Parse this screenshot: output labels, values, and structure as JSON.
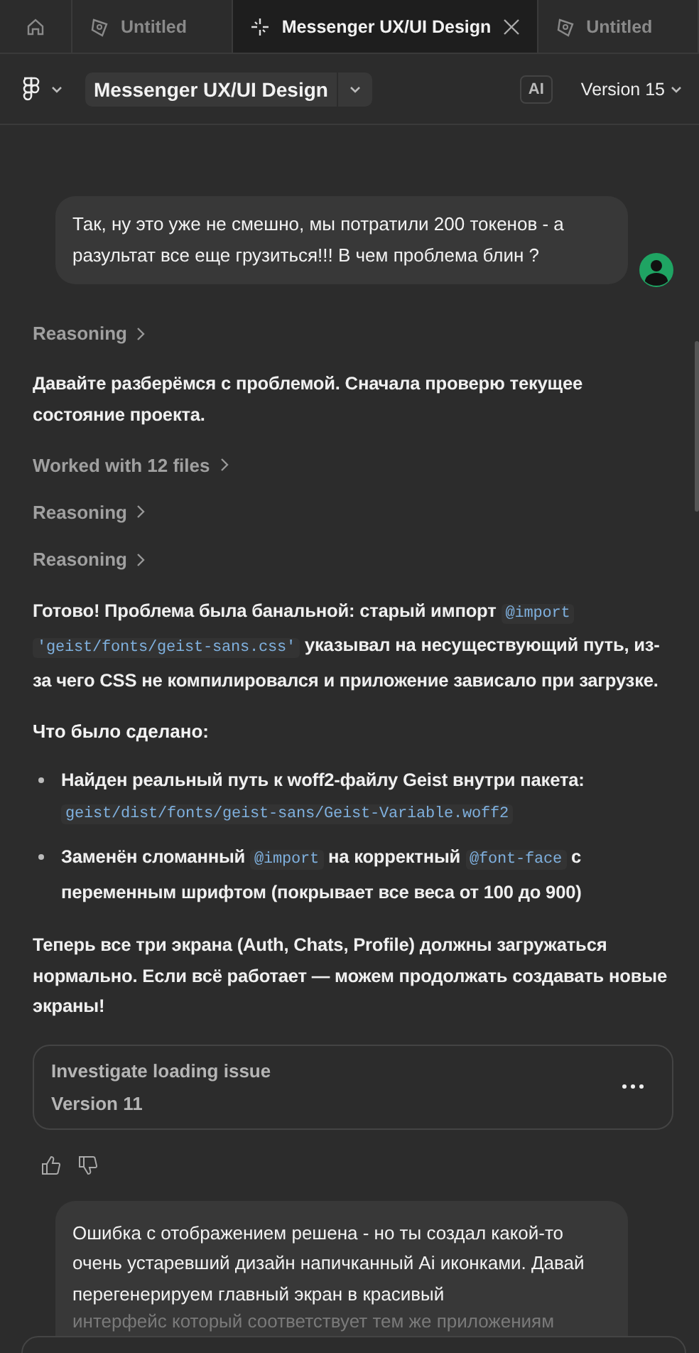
{
  "tabs": [
    {
      "kind": "home",
      "selected": false
    },
    {
      "kind": "draft",
      "label": "Untitled",
      "selected": false
    },
    {
      "kind": "design",
      "label": "Messenger UX/UI Design",
      "selected": true
    },
    {
      "kind": "draft",
      "label": "Untitled",
      "selected": false
    }
  ],
  "toolbar": {
    "file_name": "Messenger UX/UI Design",
    "ai_badge": "AI",
    "version": "Version 15"
  },
  "chat": [
    {
      "kind": "user",
      "text": "Так, ну это уже не смешно, мы потратили 200 токенов - а разультат все еще грузиться!!! В чем проблема блин ?"
    },
    {
      "kind": "step",
      "label": "Reasoning"
    },
    {
      "kind": "paragraph",
      "segments": [
        {
          "kind": "text",
          "text": "Давайте разберёмся с проблемой. Сначала проверю текущее состояние проекта."
        }
      ]
    },
    {
      "kind": "step",
      "label": "Worked with 12 files"
    },
    {
      "kind": "step",
      "label": "Reasoning"
    },
    {
      "kind": "step",
      "label": "Reasoning"
    },
    {
      "kind": "paragraph",
      "segments": [
        {
          "kind": "text",
          "text": "Готово! Проблема была банальной: старый импорт "
        },
        {
          "kind": "code",
          "text": "@import"
        },
        {
          "kind": "gap"
        },
        {
          "kind": "code",
          "text": "'geist/fonts/geist-sans.css'"
        },
        {
          "kind": "text",
          "text": " указывал на несуществующий путь, из-за чего CSS не компилировался и приложение зависало при загрузке."
        }
      ]
    },
    {
      "kind": "heading",
      "text": "Что было сделано:"
    },
    {
      "kind": "bullets",
      "items": [
        [
          {
            "kind": "text",
            "text": "Найден реальный путь к woff2-файлу Geist внутри пакета: "
          },
          {
            "kind": "code",
            "text": "geist/dist/fonts/geist-sans/Geist-Variable.woff2"
          }
        ],
        [
          {
            "kind": "text",
            "text": "Заменён сломанный "
          },
          {
            "kind": "code",
            "text": "@import"
          },
          {
            "kind": "text",
            "text": " на корректный "
          },
          {
            "kind": "code",
            "text": "@font-face"
          },
          {
            "kind": "text",
            "text": " с переменным шрифтом (покрывает все веса от 100 до 900)"
          }
        ]
      ]
    },
    {
      "kind": "paragraph",
      "segments": [
        {
          "kind": "text",
          "text": "Теперь все три экрана (Auth, Chats, Profile) должны загружаться нормально. Если всё работает — можем продолжать создавать новые экраны!"
        }
      ]
    },
    {
      "kind": "version",
      "title": "Investigate loading issue",
      "subtitle": "Version 11"
    },
    {
      "kind": "feedback"
    },
    {
      "kind": "user_partial",
      "text": "Ошибка с отображением решена - но ты создал какой-то очень устаревший дизайн напичканный Ai иконками. Давай перегенерируем главный экран в красивый",
      "faded_text": "интерфейс который соответствует тем же приложениям"
    }
  ]
}
